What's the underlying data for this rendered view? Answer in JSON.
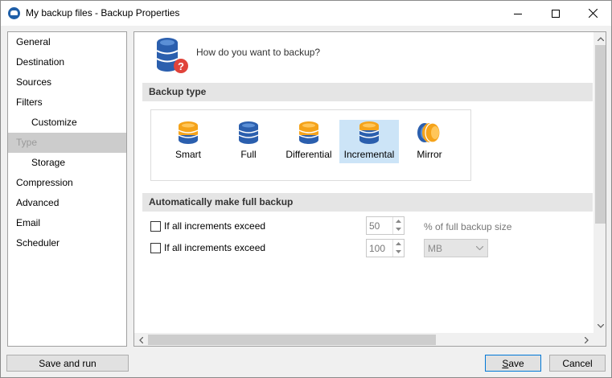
{
  "window": {
    "title": "My backup files - Backup Properties"
  },
  "sidebar": {
    "items": [
      {
        "label": "General",
        "sub": false,
        "selected": false
      },
      {
        "label": "Destination",
        "sub": false,
        "selected": false
      },
      {
        "label": "Sources",
        "sub": false,
        "selected": false
      },
      {
        "label": "Filters",
        "sub": false,
        "selected": false
      },
      {
        "label": "Customize",
        "sub": true,
        "selected": false
      },
      {
        "label": "Type",
        "sub": false,
        "selected": true
      },
      {
        "label": "Storage",
        "sub": true,
        "selected": false
      },
      {
        "label": "Compression",
        "sub": false,
        "selected": false
      },
      {
        "label": "Advanced",
        "sub": false,
        "selected": false
      },
      {
        "label": "Email",
        "sub": false,
        "selected": false
      },
      {
        "label": "Scheduler",
        "sub": false,
        "selected": false
      }
    ]
  },
  "main": {
    "question": "How do you want to backup?",
    "backup_type_heading": "Backup type",
    "types": [
      {
        "label": "Smart",
        "icon": "smart-backup-icon",
        "selected": false
      },
      {
        "label": "Full",
        "icon": "full-backup-icon",
        "selected": false
      },
      {
        "label": "Differential",
        "icon": "differential-backup-icon",
        "selected": false
      },
      {
        "label": "Incremental",
        "icon": "incremental-backup-icon",
        "selected": true
      },
      {
        "label": "Mirror",
        "icon": "mirror-backup-icon",
        "selected": false
      }
    ],
    "auto_full_heading": "Automatically make full backup",
    "rule1": {
      "label": "If all increments exceed",
      "checked": false,
      "value": "50",
      "suffix": "% of full backup size"
    },
    "rule2": {
      "label": "If all increments exceed",
      "checked": false,
      "value": "100",
      "unit": "MB"
    }
  },
  "buttons": {
    "save_and_run": "Save and run",
    "save_prefix": "",
    "save_underlined": "S",
    "save_rest": "ave",
    "cancel": "Cancel"
  },
  "colors": {
    "orange_disk": "#f5a31a",
    "blue_disk": "#2b5fae",
    "selection": "#cce4f7",
    "accent_border": "#0078d7",
    "question_badge": "#e0433a"
  }
}
